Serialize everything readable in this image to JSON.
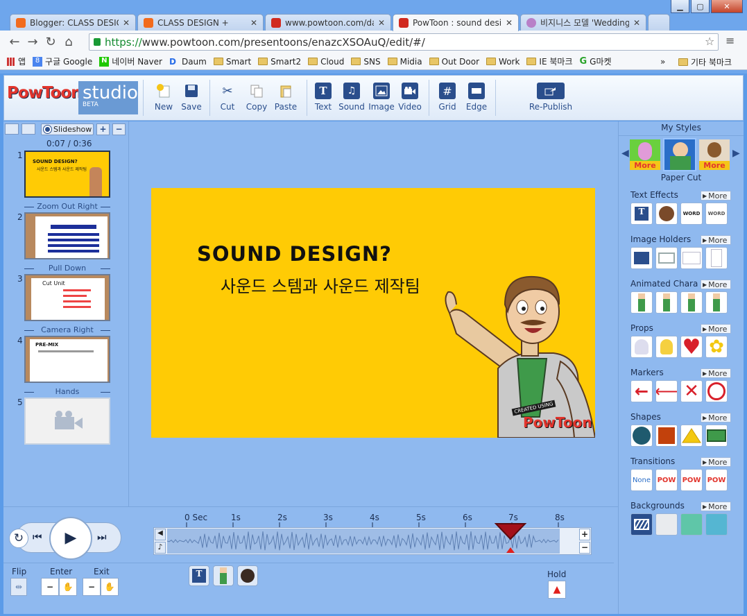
{
  "browser": {
    "tabs": [
      {
        "title": "Blogger: CLASS DESIGN",
        "icon": "blogger-icon",
        "color": "#f26b1d"
      },
      {
        "title": "CLASS DESIGN +",
        "icon": "blogger-icon",
        "color": "#f26b1d"
      },
      {
        "title": "www.powtoon.com/das",
        "icon": "powtoon-icon",
        "color": "#d12a1f"
      },
      {
        "title": "PowToon : sound desig",
        "icon": "powtoon-icon",
        "color": "#d12a1f"
      },
      {
        "title": "비지니스 모델 'Wedding",
        "icon": "web-icon",
        "color": "#b880c8"
      }
    ],
    "url_scheme": "https://",
    "url_rest": "www.powtoon.com/presentoons/enazcXSOAuQ/edit/#/",
    "bookmarks": [
      "앱",
      "구글 Google",
      "네이버 Naver",
      "Daum",
      "Smart",
      "Smart2",
      "Cloud",
      "SNS",
      "Midia",
      "Out Door",
      "Work",
      "IE 북마크",
      "G마켓"
    ],
    "bookmarks_overflow": "»",
    "bookmarks_other": "기타 북마크"
  },
  "app": {
    "logo": "PowToon",
    "studio": "studio",
    "beta": "BETA",
    "toolbar": [
      "New",
      "Save",
      "Cut",
      "Copy",
      "Paste",
      "Text",
      "Sound",
      "Image",
      "Video",
      "Grid",
      "Edge"
    ],
    "republish": "Re-Publish"
  },
  "left": {
    "mode": "Slideshow",
    "time": "0:07 / 0:36",
    "slides": [
      {
        "num": "1",
        "transition": "Zoom Out Right"
      },
      {
        "num": "2",
        "transition": "Pull Down"
      },
      {
        "num": "3",
        "transition": "Camera Right"
      },
      {
        "num": "4",
        "transition": "Hands"
      },
      {
        "num": "5",
        "transition": ""
      }
    ],
    "slide3_title": "Cut Unit",
    "slide4_title": "PRE-MIX"
  },
  "slide": {
    "title": "SOUND DESIGN?",
    "subtitle": "사운드 스템과 사운드 제작팀",
    "watermark_small": "CREATED USING",
    "watermark_big": "PowToon"
  },
  "right": {
    "my_styles": "My Styles",
    "style_more": "More",
    "style_name": "Paper Cut",
    "more_label": "More",
    "sections": [
      "Text Effects",
      "Image Holders",
      "Animated Charact",
      "Props",
      "Markers",
      "Shapes",
      "Transitions",
      "Backgrounds"
    ],
    "transitions_none": "None",
    "pow": "POW"
  },
  "timeline": {
    "ticks": [
      "0 Sec",
      "1s",
      "2s",
      "3s",
      "4s",
      "5s",
      "6s",
      "7s",
      "8s"
    ],
    "flip": "Flip",
    "enter": "Enter",
    "exit": "Exit",
    "hold": "Hold"
  },
  "colors": {
    "slide_bg": "#ffcb05",
    "panel": "#8fb9ef",
    "accent": "#2a4e8c",
    "playhead": "#c0141c"
  }
}
